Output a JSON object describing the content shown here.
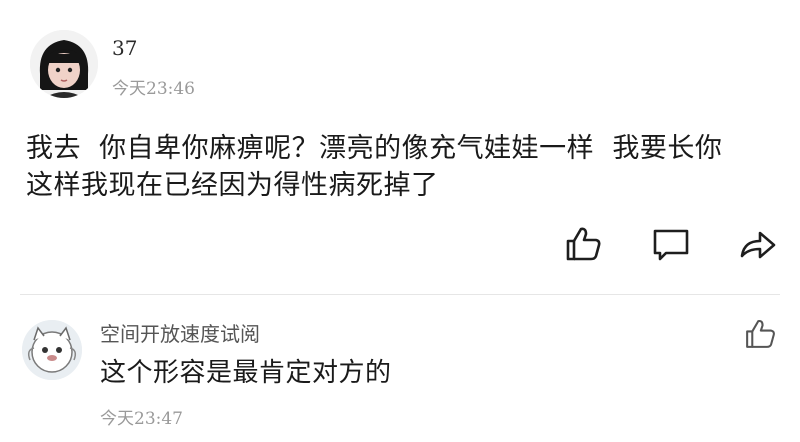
{
  "post": {
    "username": "37",
    "time": "今天23:46",
    "content": "我去  你自卑你麻痹呢？漂亮的像充气娃娃一样  我要长你\n这样我现在已经因为得性病死掉了",
    "actions": {
      "like_icon": "thumbs-up-icon",
      "comment_icon": "comment-icon",
      "share_icon": "share-icon"
    }
  },
  "reply": {
    "username": "空间开放速度试阅",
    "text": "这个形容是最肯定对方的",
    "time": "今天23:47",
    "like_icon": "thumbs-up-icon"
  },
  "colors": {
    "text": "#1a1a1a",
    "muted": "#9a9a9a",
    "divider": "#e6e6e6"
  }
}
